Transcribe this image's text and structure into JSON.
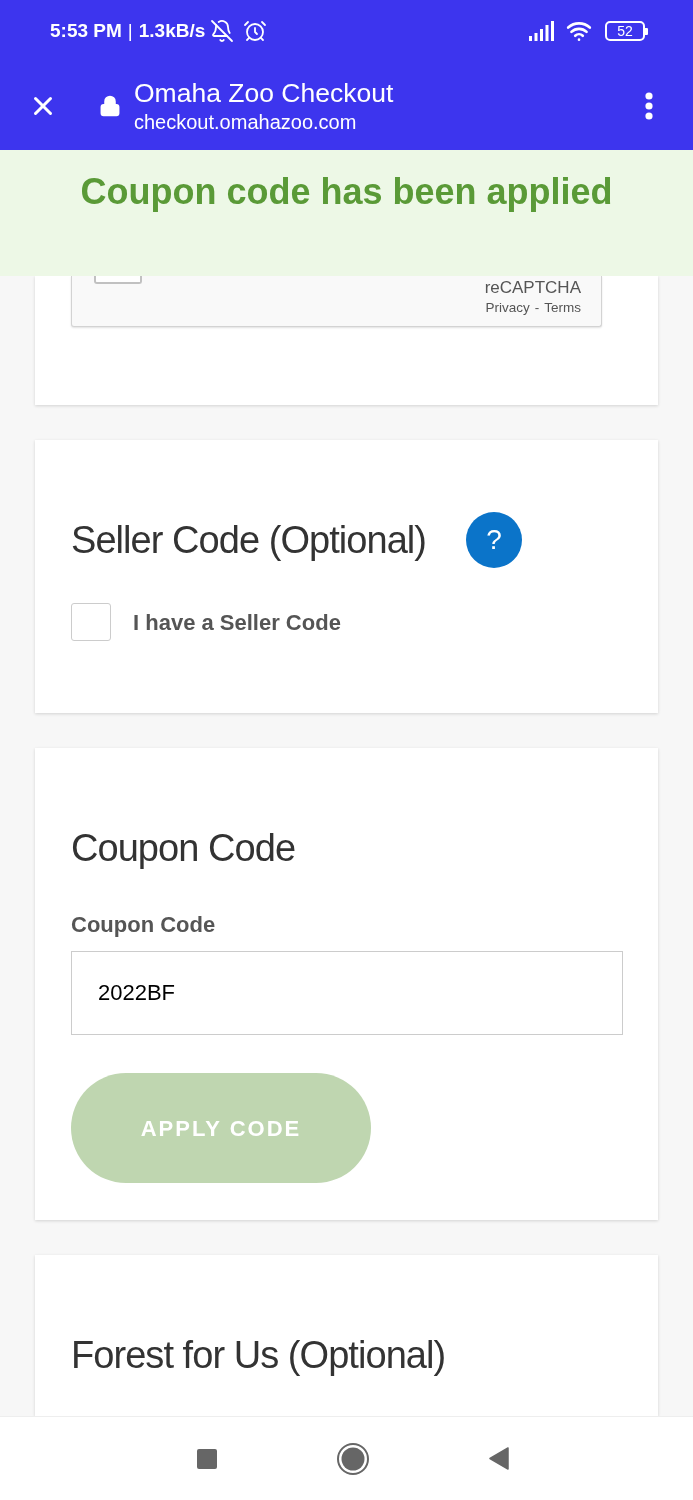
{
  "status_bar": {
    "time": "5:53 PM",
    "separator": "|",
    "speed": "1.3kB/s",
    "battery": "52"
  },
  "browser_bar": {
    "title": "Omaha Zoo Checkout",
    "url": "checkout.omahazoo.com"
  },
  "toast": {
    "message": "Coupon code has been applied"
  },
  "sections": [
    {
      "kind": "recaptcha",
      "checked": false,
      "brand": "reCAPTCHA",
      "links": [
        "Privacy",
        "Terms"
      ],
      "separator": "-"
    },
    {
      "kind": "checkbox",
      "heading": "Seller Code (Optional)",
      "help": "?",
      "checkbox": {
        "label": "I have a Seller Code",
        "checked": false
      }
    },
    {
      "kind": "coupon",
      "heading": "Coupon Code",
      "field": {
        "label": "Coupon Code",
        "value": "2022BF"
      },
      "button": {
        "label": "APPLY CODE",
        "disabled": true
      }
    },
    {
      "kind": "heading",
      "heading": "Forest for Us (Optional)"
    }
  ]
}
